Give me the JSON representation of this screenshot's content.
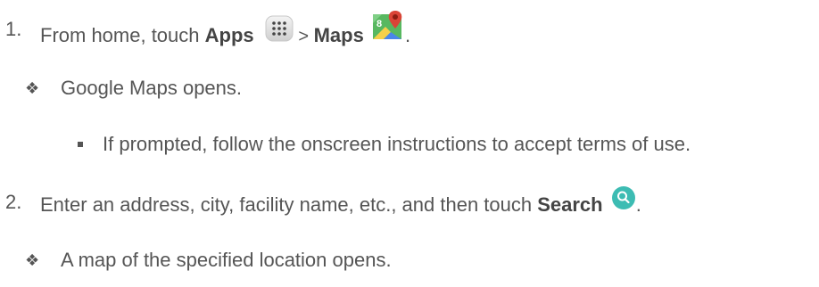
{
  "steps": [
    {
      "number": "1.",
      "prefix": "From home, touch ",
      "apps_label": "Apps",
      "sep": " > ",
      "maps_label": "Maps",
      "suffix": "."
    },
    {
      "number": "2.",
      "prefix": "Enter an address, city, facility name, etc., and then touch ",
      "search_label": "Search",
      "suffix": "."
    }
  ],
  "result1": "Google Maps opens.",
  "sub1": "If prompted, follow the onscreen instructions to accept terms of use.",
  "result2": "A map of the specified location opens.",
  "colors": {
    "text": "#555555",
    "search_icon": "#3dbcb3",
    "maps_green": "#58b860",
    "maps_red": "#db4437"
  },
  "icons": [
    "apps-grid-icon",
    "google-maps-icon",
    "search-magnifier-icon",
    "diamond-bullet-icon",
    "square-bullet-icon"
  ]
}
